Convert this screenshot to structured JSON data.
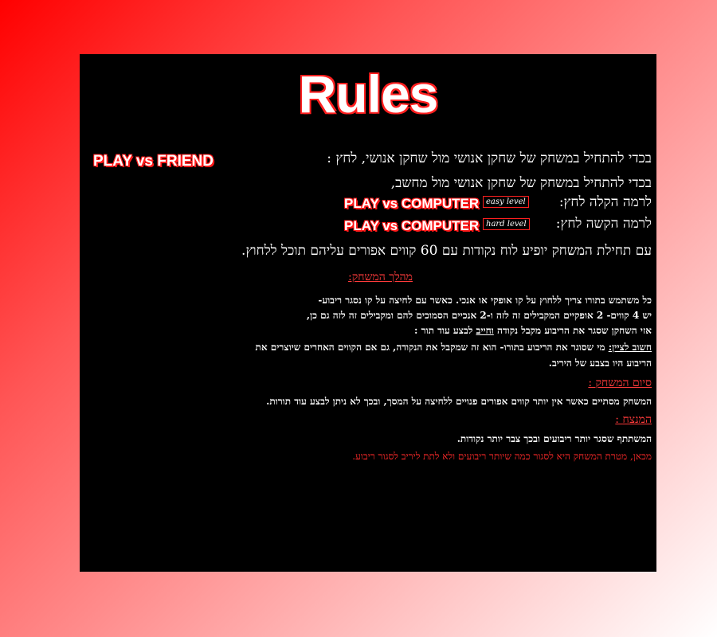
{
  "title": "Rules",
  "lines": {
    "friend": "בכדי להתחיל במשחק של שחקן אנושי מול שחקן אנושי, לחץ :",
    "computer": "בכדי להתחיל במשחק של שחקן אנושי מול מחשב,",
    "easy": "לרמה הקלה לחץ:",
    "hard": "לרמה הקשה לחץ:",
    "board": "עם תחילת המשחק יופיע לוח נקודות עם 60 קווים אפורים עליהם תוכל ללחוץ."
  },
  "buttons": {
    "play_friend": "PLAY vs FRIEND",
    "play_computer_easy": "PLAY vs COMPUTER",
    "play_computer_hard": "PLAY vs COMPUTER",
    "easy_tag": "easy level",
    "hard_tag": "hard level"
  },
  "sections": {
    "flow_title": "מהלך המשחק:",
    "flow_1": "כל משתמש בתורו צריך ללחוץ על קו אופקי או אנכי. כאשר עם לחיצה על קו נסגר ריבוע-",
    "flow_2": "יש 4 קווים- 2 אופקיים המקבילים זה לזה ו-2 אנכיים הסמוכים להם ומקבילים זה לזה גם כן,",
    "flow_3a": "אזי השחקן שסגר את הריבוע מקבל נקודה ",
    "flow_3b": "וחייב",
    "flow_3c": " לבצע עוד תור :",
    "note_label": "חשוב לציין:",
    "note_1": " מי שסוגר את הריבוע בתורו- הוא זה שמקבל את הנקודה, גם אם הקווים האחרים שיוצרים את",
    "note_2": "הריבוע היו בצבע של היריב.",
    "end_title": "סיום המשחק :",
    "end_1": "המשחק מסתיים כאשר אין יותר קווים אפורים פנויים ללחיצה על המסך, ובכך לא ניתן לבצע עוד תורות.",
    "winner_title": "המנצח",
    "winner_colon": " :",
    "winner_1": "המשתתף שסגר יותר ריבועים ובכך צבר יותר נקודות.",
    "goal": "מכאן, מטרת המשחק היא לסגור כמה שיותר ריבועים ולא לתת ליריב לסגור ריבוע."
  }
}
